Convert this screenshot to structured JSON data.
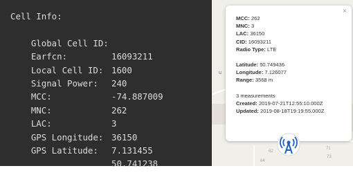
{
  "terminal": {
    "heading": "Cell Info:",
    "rows": [
      {
        "label": "Global Cell ID:",
        "value": "16093211"
      },
      {
        "label": "Earfcn:",
        "value": "1600"
      },
      {
        "label": "Local Cell ID:",
        "value": "240"
      },
      {
        "label": "Signal Power:",
        "value": "-74.887009"
      },
      {
        "label": "MCC:",
        "value": "262"
      },
      {
        "label": "MNC:",
        "value": "3"
      },
      {
        "label": "LAC:",
        "value": "36150"
      },
      {
        "label": "GPS Longitude:",
        "value": "7.131455"
      },
      {
        "label": "GPS Latitude:",
        "value": "50.741238"
      }
    ]
  },
  "popup": {
    "close_glyph": "×",
    "mcc_label": "MCC:",
    "mcc": "262",
    "mnc_label": "MNC:",
    "mnc": "3",
    "lac_label": "LAC:",
    "lac": "36150",
    "cid_label": "CID:",
    "cid": "16093211",
    "radio_label": "Radio Type:",
    "radio": "LTE",
    "lat_label": "Latitude:",
    "lat": "50.749436",
    "lon_label": "Longitude:",
    "lon": "7.126077",
    "range_label": "Range:",
    "range": "3568 m",
    "measurements": "3 measurements",
    "created_label": "Created:",
    "created": "2019-07-21T12:55:10.000Z",
    "updated_label": "Updated:",
    "updated": "2019-08-18T19:19:55.000Z"
  },
  "map": {
    "side_char": "u",
    "numbers": [
      "62",
      "71",
      "73",
      "64"
    ],
    "tower_icon": "cell-tower-icon",
    "tower_color": "#1f5fc0"
  }
}
